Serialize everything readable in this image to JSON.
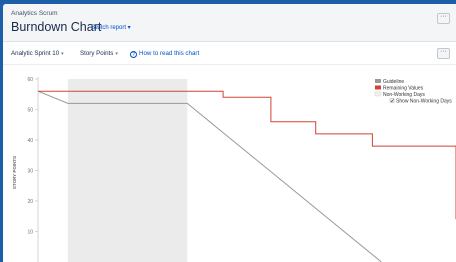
{
  "header": {
    "project": "Analytics Scrum",
    "title": "Burndown Chart",
    "switch_label": "Switch report",
    "more_label": "···"
  },
  "toolbar": {
    "sprint": "Analytic Sprint 10",
    "estimate": "Story Points",
    "help": "How to read this chart",
    "more_label": "···"
  },
  "chart_data": {
    "type": "line",
    "ylabel": "STORY POINTS",
    "ylim": [
      0,
      60
    ],
    "yticks": [
      10,
      20,
      30,
      40,
      50,
      60
    ],
    "grid": false,
    "legend_position": "top-right",
    "legend": [
      "Guideline",
      "Remaining Values",
      "Non-Working Days"
    ],
    "show_non_working_days": {
      "label": "Show Non-Working Days",
      "checked": true
    },
    "non_working_span": [
      1,
      5
    ],
    "xlim": [
      0,
      14
    ],
    "series": [
      {
        "name": "Guideline",
        "color": "#999999",
        "points": [
          [
            0,
            56
          ],
          [
            1,
            52
          ],
          [
            5,
            52
          ],
          [
            11.5,
            0
          ]
        ]
      },
      {
        "name": "Remaining Values",
        "color": "#d04437",
        "points": [
          [
            0,
            56
          ],
          [
            6.2,
            56
          ],
          [
            6.2,
            54
          ],
          [
            7.8,
            54
          ],
          [
            7.8,
            46
          ],
          [
            9.3,
            46
          ],
          [
            9.3,
            42
          ],
          [
            11.2,
            42
          ],
          [
            11.2,
            38
          ],
          [
            14,
            38
          ],
          [
            14,
            14
          ]
        ]
      }
    ],
    "colors": {
      "non_working": "#ebebeb",
      "legend_non_working": "#f0f0f0"
    }
  }
}
